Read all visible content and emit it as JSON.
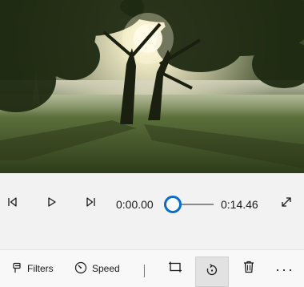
{
  "player": {
    "current_time": "0:00.00",
    "total_time": "0:14.46",
    "progress": 0.0
  },
  "toolbar": {
    "filters_label": "Filters",
    "speed_label": "Speed",
    "more_label": "···"
  },
  "icons": {
    "previous_frame": "previous-frame-icon",
    "play": "play-icon",
    "next_frame": "next-frame-icon",
    "fullscreen": "expand-icon",
    "filters": "filters-icon",
    "speed": "speed-icon",
    "crop": "crop-icon",
    "rotate": "rotate-icon",
    "delete": "trash-icon"
  },
  "colors": {
    "accent": "#0a6cc9",
    "background": "#f2f2f2"
  }
}
